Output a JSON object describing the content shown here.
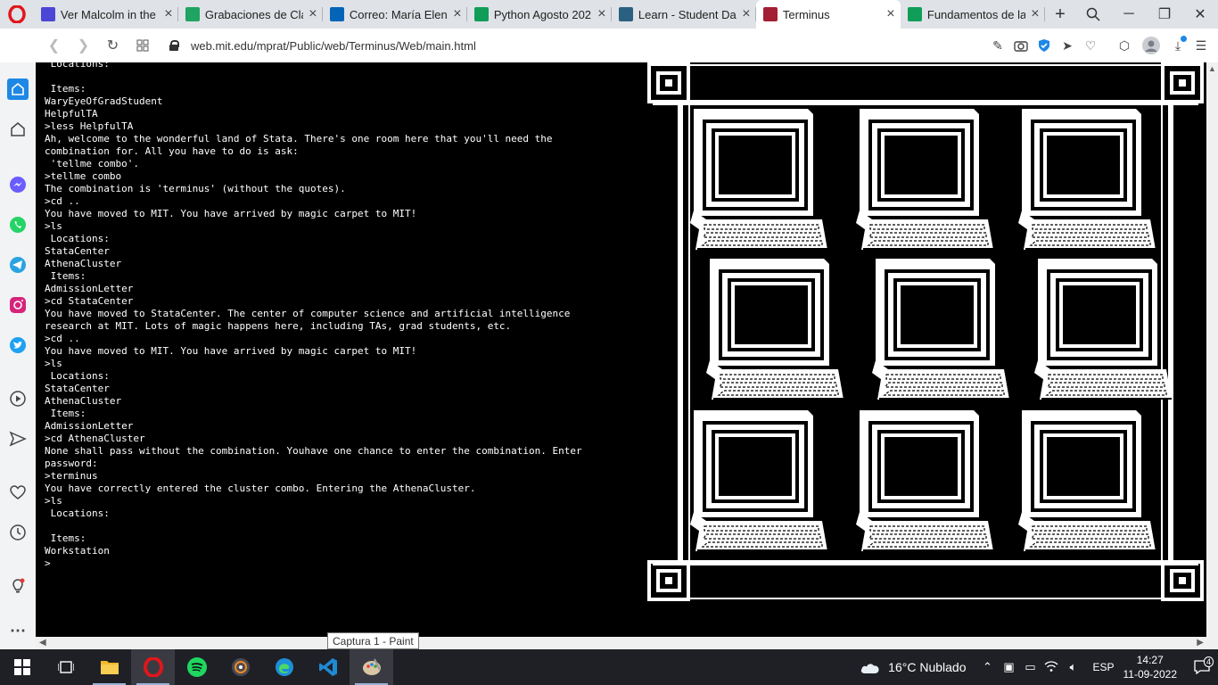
{
  "browser": {
    "tabs": [
      {
        "label": "Ver Malcolm in the",
        "icon": "opera-player-icon",
        "color": "#4b46d6"
      },
      {
        "label": "Grabaciones de Cla",
        "icon": "google-drive-icon",
        "color": "#1fa463"
      },
      {
        "label": "Correo: María Elena",
        "icon": "outlook-icon",
        "color": "#0364b8"
      },
      {
        "label": "Python Agosto 202",
        "icon": "google-sheets-icon",
        "color": "#0f9d58"
      },
      {
        "label": "Learn - Student Da",
        "icon": "learn-icon",
        "color": "#2a6080"
      },
      {
        "label": "Terminus",
        "icon": "mit-icon",
        "color": "#a31f34",
        "active": true
      },
      {
        "label": "Fundamentos de la",
        "icon": "google-sheets-icon",
        "color": "#0f9d58"
      }
    ],
    "url": "web.mit.edu/mprat/Public/web/Terminus/Web/main.html"
  },
  "terminal": {
    "lines": [
      " Locations:",
      "",
      " Items:",
      "WaryEyeOfGradStudent",
      "HelpfulTA",
      ">less HelpfulTA",
      "Ah, welcome to the wonderful land of Stata. There's one room here that you'll need the",
      "combination for. All you have to do is ask:",
      " 'tellme combo'.",
      ">tellme combo",
      "The combination is 'terminus' (without the quotes).",
      ">cd ..",
      "You have moved to MIT. You have arrived by magic carpet to MIT!",
      ">ls",
      " Locations:",
      "StataCenter",
      "AthenaCluster",
      " Items:",
      "AdmissionLetter",
      ">cd StataCenter",
      "You have moved to StataCenter. The center of computer science and artificial intelligence",
      "research at MIT. Lots of magic happens here, including TAs, grad students, etc.",
      ">cd ..",
      "You have moved to MIT. You have arrived by magic carpet to MIT!",
      ">ls",
      " Locations:",
      "StataCenter",
      "AthenaCluster",
      " Items:",
      "AdmissionLetter",
      ">cd AthenaCluster",
      "None shall pass without the combination. Youhave one chance to enter the combination. Enter",
      "password:",
      ">terminus",
      "You have correctly entered the cluster combo. Entering the AthenaCluster.",
      ">ls",
      " Locations:",
      "",
      " Items:",
      "Workstation",
      ">"
    ]
  },
  "tooltip": "Captura 1 - Paint",
  "taskbar": {
    "weather": "16°C  Nublado",
    "lang": "ESP",
    "time": "14:27",
    "date": "11-09-2022",
    "notification_count": "4"
  }
}
